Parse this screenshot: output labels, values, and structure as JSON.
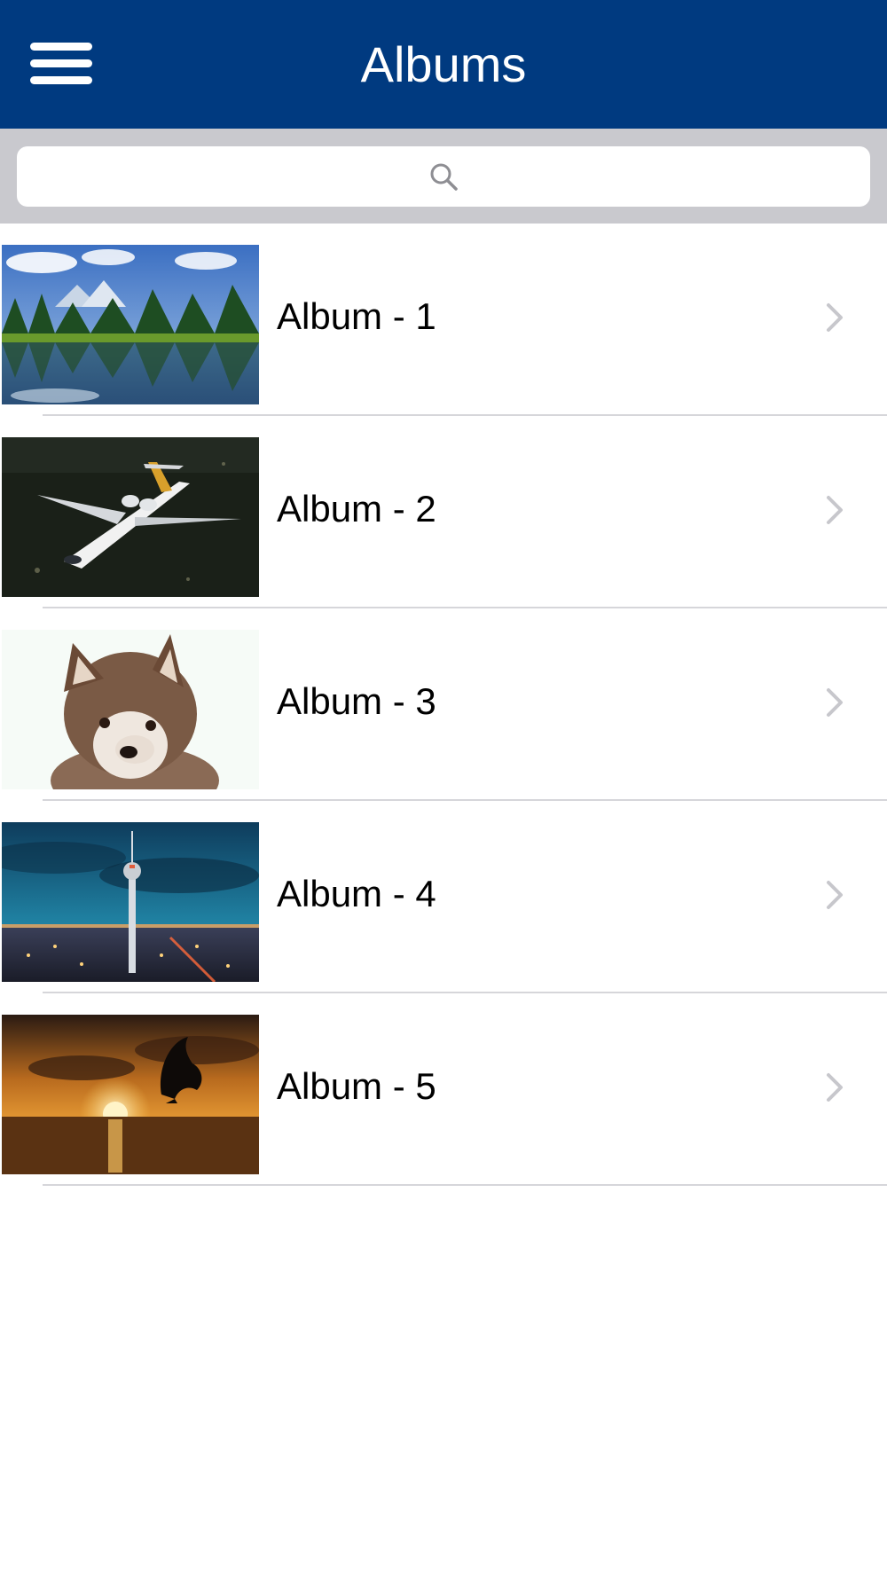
{
  "nav": {
    "title": "Albums",
    "menu_icon": "hamburger-menu-icon",
    "background_color": "#003a80"
  },
  "search": {
    "placeholder": "",
    "value": "",
    "icon": "search-icon"
  },
  "albums": [
    {
      "label": "Album - 1",
      "thumbnail": "mountain-lake-photo"
    },
    {
      "label": "Album - 2",
      "thumbnail": "private-jet-photo"
    },
    {
      "label": "Album - 3",
      "thumbnail": "puppy-photo"
    },
    {
      "label": "Album - 4",
      "thumbnail": "city-tv-tower-night-photo"
    },
    {
      "label": "Album - 5",
      "thumbnail": "dolphin-sunset-photo"
    }
  ],
  "row_chevron_icon": "chevron-right-icon"
}
